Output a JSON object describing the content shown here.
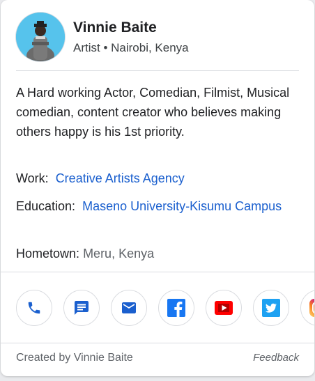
{
  "profile": {
    "name": "Vinnie Baite",
    "subtitle": "Artist • Nairobi, Kenya",
    "bio": "A Hard working Actor, Comedian, Filmist, Musical comedian, content creator who believes making others happy is his 1st priority."
  },
  "details": {
    "work_label": "Work:",
    "work_value": "Creative Artists Agency",
    "education_label": "Education:",
    "education_value": "Maseno University-Kisumu Campus",
    "hometown_label": "Hometown:",
    "hometown_value": "Meru, Kenya"
  },
  "actions": [
    {
      "icon": "phone-icon"
    },
    {
      "icon": "message-icon"
    },
    {
      "icon": "email-icon"
    },
    {
      "icon": "facebook-icon"
    },
    {
      "icon": "youtube-icon"
    },
    {
      "icon": "twitter-icon"
    },
    {
      "icon": "instagram-icon"
    }
  ],
  "colors": {
    "link": "#1a5fce",
    "facebook": "#1877f2",
    "youtube": "#ff0000",
    "twitter": "#1da1f2"
  },
  "footer": {
    "created_by": "Created by Vinnie Baite",
    "feedback": "Feedback"
  }
}
